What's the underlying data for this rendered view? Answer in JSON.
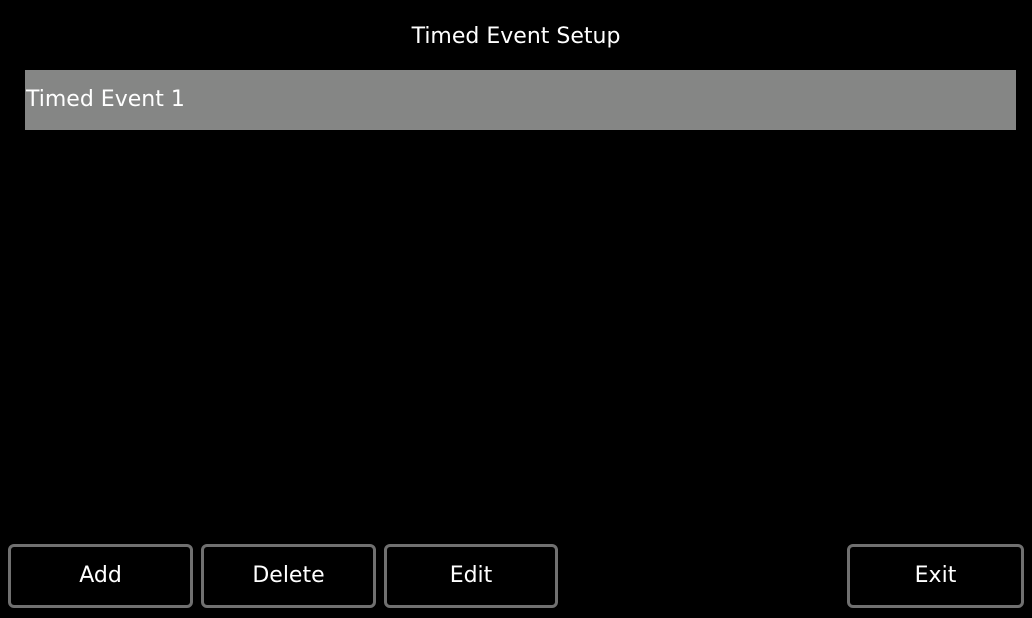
{
  "header": {
    "title": "Timed Event Setup"
  },
  "events": {
    "items": [
      {
        "label": "Timed Event 1",
        "selected": true
      }
    ]
  },
  "toolbar": {
    "add_label": "Add",
    "delete_label": "Delete",
    "edit_label": "Edit",
    "exit_label": "Exit"
  },
  "colors": {
    "background": "#000000",
    "selected_row": "#858685",
    "button_border": "#707070",
    "text": "#ffffff"
  }
}
